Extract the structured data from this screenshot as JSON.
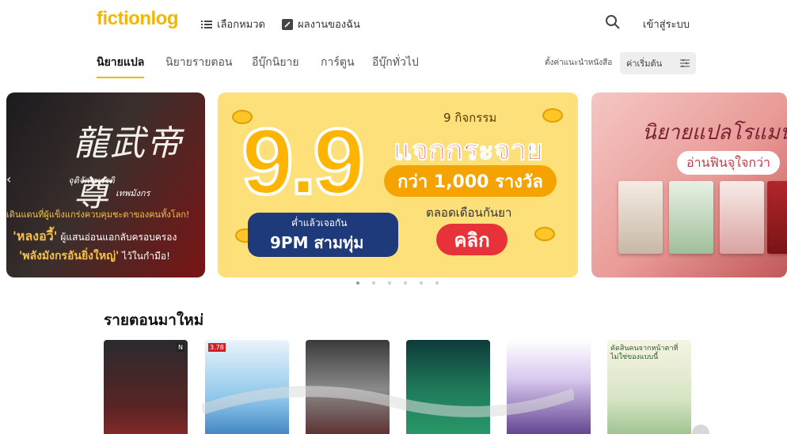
{
  "header": {
    "logo": "fictionlog",
    "categories_label": "เลือกหมวด",
    "my_works_label": "ผลงานของฉัน",
    "login_label": "เข้าสู่ระบบ"
  },
  "tabs": [
    {
      "label": "นิยายแปล",
      "active": true
    },
    {
      "label": "นิยายรายตอน",
      "active": false
    },
    {
      "label": "อีบุ๊กนิยาย",
      "active": false
    },
    {
      "label": "การ์ตูน",
      "active": false
    },
    {
      "label": "อีบุ๊กทั่วไป",
      "active": false
    }
  ],
  "recommend": {
    "label": "ตั้งค่าแนะนำหนังสือ",
    "value": "ค่าเริ่มต้น"
  },
  "banners": {
    "left": {
      "title_glyph": "龍武帝尊",
      "sub1": "จุติจักรพรรดิ",
      "sub2": "เทพมังกร",
      "line1": "เดินแดนที่ผู้แข็งแกร่งควบคุมชะตาของคนทั้งโลก!",
      "line2_hl": "'หลงอวี้'",
      "line2_rest": " ผู้แสนอ่อนแอกลับครอบครอง",
      "line3_hl": "'พลังมังกรอันยิ่งใหญ่'",
      "line3_rest": " ไว้ในกำมือ!"
    },
    "center": {
      "big": "9.9",
      "top": "9 กิจกรรม",
      "headline": "แจกกระจาย",
      "prize": "กว่า 1,000 รางวัล",
      "month": "ตลอดเดือนกันยา",
      "click": "คลิก",
      "night_small": "ค่ำแล้วเจอกัน",
      "night_big": "9PM สามทุ่ม"
    },
    "right": {
      "title": "นิยายแปลโรแมนติก",
      "pill": "อ่านฟินจุใจกว่า"
    }
  },
  "carousel_dots": 6,
  "carousel_active": 0,
  "section": {
    "title": "รายตอนมาใหม่"
  },
  "covers": [
    {
      "tag": "N",
      "label": ""
    },
    {
      "tag": "3.78",
      "label": ""
    },
    {
      "tag": "",
      "label": ""
    },
    {
      "tag": "",
      "label": ""
    },
    {
      "tag": "",
      "label": ""
    },
    {
      "tag": "",
      "label": "คัดสินคนจากหน้าตาที่ไม่ใช่ของแบบนี้"
    }
  ],
  "colors": {
    "brand_yellow": "#f2b705",
    "accent_red": "#e8323a",
    "tab_underline": "#f2b705",
    "select_bg": "#eeeeee"
  },
  "icons": {
    "categories": "list-icon",
    "my_works": "bookmark-icon",
    "search": "search-icon",
    "filter": "filter-icon",
    "next": "chevron-right-icon",
    "prev": "chevron-left-icon"
  }
}
